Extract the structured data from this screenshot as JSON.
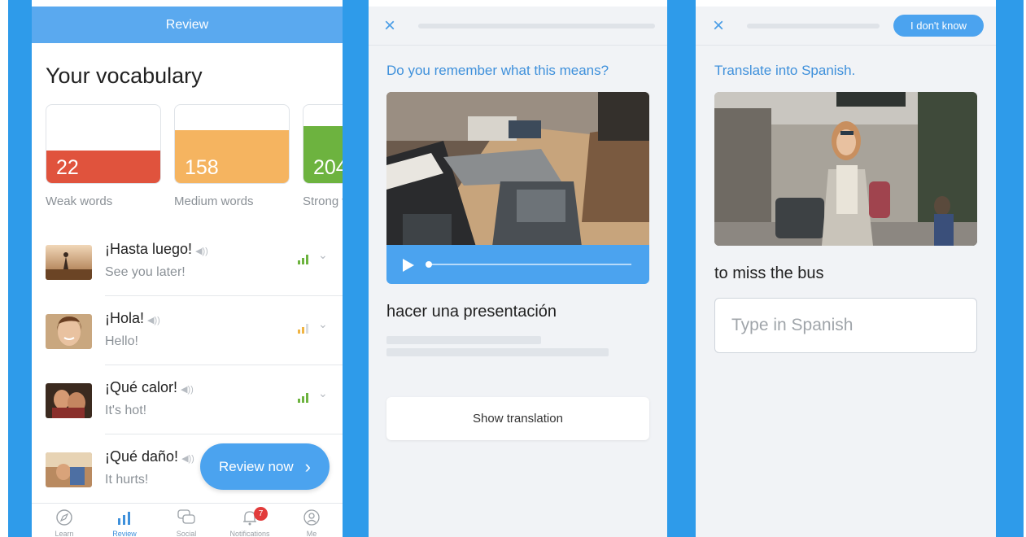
{
  "colors": {
    "brand_blue": "#2e9bea",
    "header_blue": "#5aa9ef",
    "accent_blue": "#4ba3ef",
    "prompt_blue": "#3e90db",
    "weak_red": "#e0533d",
    "medium_orange": "#f5b460",
    "strong_green": "#6db33f",
    "badge_red": "#e23b3b"
  },
  "review": {
    "header_title": "Review",
    "heading": "Your vocabulary",
    "stats": [
      {
        "count": "22",
        "caption": "Weak words",
        "level": 0.42
      },
      {
        "count": "158",
        "caption": "Medium words",
        "level": 0.68
      },
      {
        "count": "204",
        "caption": "Strong words",
        "level": 0.73
      }
    ],
    "words": [
      {
        "word": "¡Hasta luego!",
        "translation": "See you later!",
        "strength_icon": "signal-strong-icon"
      },
      {
        "word": "¡Hola!",
        "translation": "Hello!",
        "strength_icon": "signal-medium-icon"
      },
      {
        "word": "¡Qué calor!",
        "translation": "It's hot!",
        "strength_icon": "signal-strong-icon"
      },
      {
        "word": "¡Qué daño!",
        "translation": "It hurts!",
        "strength_icon": "signal-strong-icon"
      }
    ],
    "review_now_label": "Review now",
    "review_now_arrow": "›",
    "tabs": [
      {
        "label": "Learn",
        "icon": "compass-icon"
      },
      {
        "label": "Review",
        "icon": "bar-chart-icon"
      },
      {
        "label": "Social",
        "icon": "chat-icon"
      },
      {
        "label": "Notifications",
        "icon": "bell-icon"
      },
      {
        "label": "Me",
        "icon": "user-icon"
      }
    ],
    "notification_count": "7"
  },
  "flashcard": {
    "close_glyph": "×",
    "prompt": "Do you remember what this means?",
    "phrase": "hacer una presentación",
    "show_translation_label": "Show translation"
  },
  "translate": {
    "close_glyph": "×",
    "dont_know_label": "I don't know",
    "prompt": "Translate into Spanish.",
    "phrase": "to miss the bus",
    "input_placeholder": "Type in Spanish"
  }
}
